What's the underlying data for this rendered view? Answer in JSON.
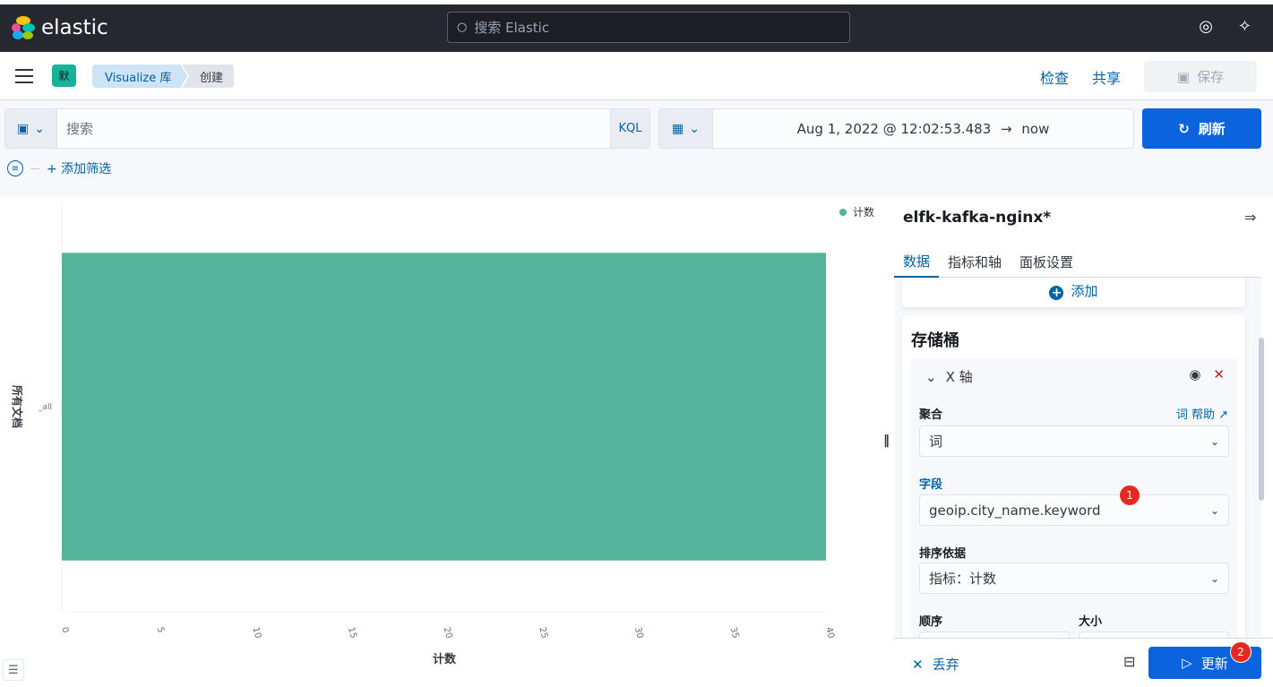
{
  "header": {
    "logo_text": "elastic",
    "search_placeholder": "搜索 Elastic"
  },
  "breadcrumbs": {
    "space_initial": "默",
    "items": [
      "Visualize 库",
      "创建"
    ]
  },
  "top_actions": {
    "inspect": "检查",
    "share": "共享",
    "save": "保存"
  },
  "query": {
    "placeholder": "搜索",
    "language": "KQL",
    "time_range": "Aug 1, 2022 @ 12:02:53.483",
    "time_arrow": "→",
    "time_end": "now",
    "refresh": "刷新",
    "add_filter": "+ 添加筛选"
  },
  "chart_data": {
    "type": "bar",
    "orientation": "horizontal",
    "categories": [
      "_all"
    ],
    "series": [
      {
        "name": "计数",
        "values": [
          40
        ]
      }
    ],
    "xlabel": "计数",
    "ylabel": "所有文档",
    "xlim": [
      0,
      40
    ],
    "xticks": [
      0,
      5,
      10,
      15,
      20,
      25,
      30,
      35,
      40
    ],
    "legend_position": "top-right",
    "color": "#54b399"
  },
  "sidebar": {
    "index_pattern": "elfk-kafka-nginx*",
    "tabs": [
      "数据",
      "指标和轴",
      "面板设置"
    ],
    "add_label": "添加",
    "buckets_title": "存储桶",
    "agg_title": "X 轴",
    "aggregation_label": "聚合",
    "aggregation_help": "词 帮助",
    "aggregation_value": "词",
    "field_label": "字段",
    "field_value": "geoip.city_name.keyword",
    "order_by_label": "排序依据",
    "order_by_value": "指标：计数",
    "order_label": "顺序",
    "size_label": "大小",
    "discard": "丢弃",
    "update": "更新"
  },
  "badges": {
    "field_badge": "1",
    "update_badge": "2"
  }
}
